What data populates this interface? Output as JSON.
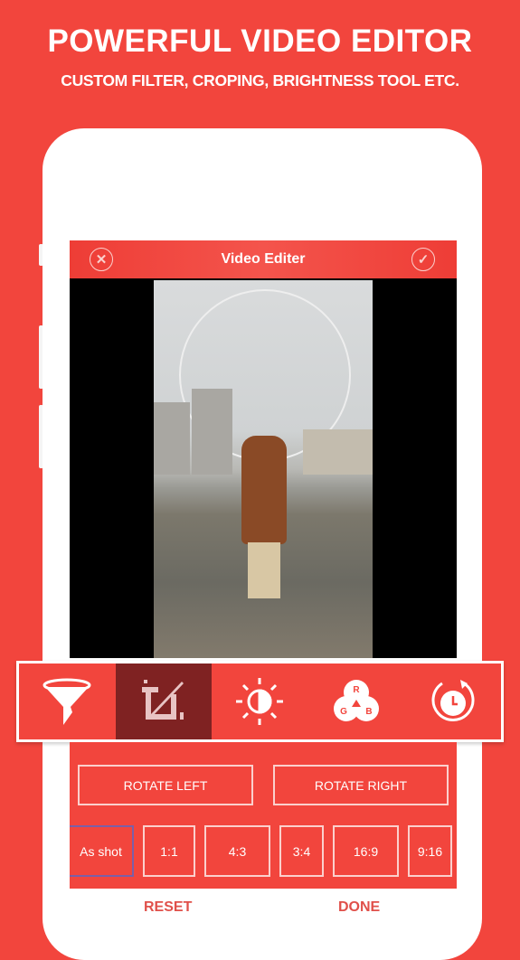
{
  "promo": {
    "title": "POWERFUL VIDEO EDITOR",
    "subtitle": "CUSTOM FILTER, CROPING, BRIGHTNESS TOOL ETC."
  },
  "colors": {
    "brand": "#f2453d",
    "active_tool": "#7f2222",
    "selected_ratio_border": "#7b5fa8"
  },
  "header": {
    "title": "Video Editer",
    "close_icon": "close-circle-icon",
    "confirm_icon": "check-circle-icon"
  },
  "toolbar": {
    "active": "crop",
    "tools": [
      {
        "id": "filter",
        "icon": "funnel-icon"
      },
      {
        "id": "crop",
        "icon": "crop-icon"
      },
      {
        "id": "brightness",
        "icon": "brightness-contrast-icon"
      },
      {
        "id": "rgb",
        "icon": "rgb-icon",
        "letters": [
          "R",
          "G",
          "B"
        ]
      },
      {
        "id": "speed",
        "icon": "timer-rotate-icon"
      }
    ]
  },
  "crop": {
    "rotate_left": "ROTATE LEFT",
    "rotate_right": "ROTATE RIGHT",
    "selected_ratio": "As shot",
    "ratios": [
      "As shot",
      "1:1",
      "4:3",
      "3:4",
      "16:9",
      "9:16"
    ]
  },
  "footer": {
    "reset": "RESET",
    "done": "DONE"
  }
}
